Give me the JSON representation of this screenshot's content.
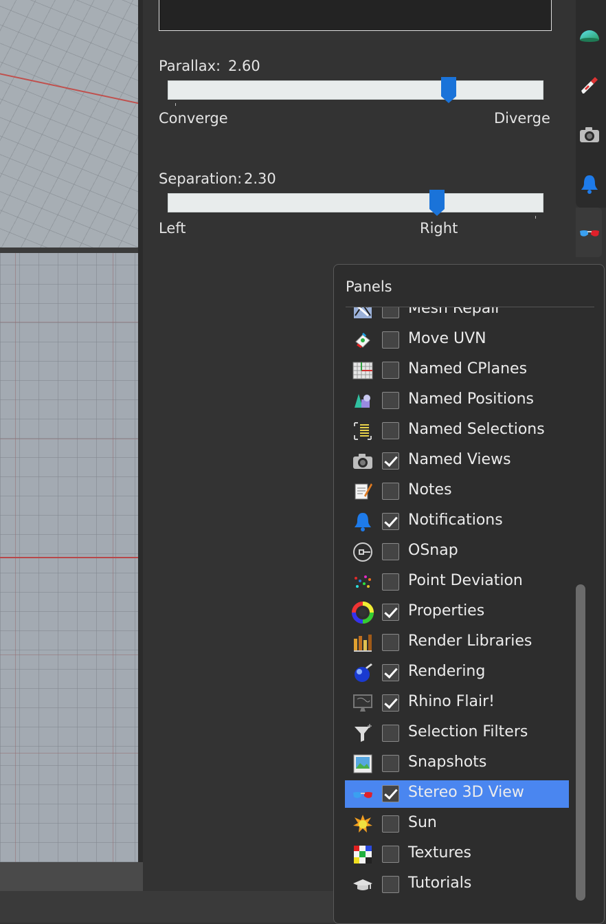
{
  "stereo": {
    "parallax": {
      "label": "Parallax:",
      "value": "2.60",
      "level": 0.75,
      "left_label": "Converge",
      "right_label": "Diverge"
    },
    "separation": {
      "label": "Separation:",
      "value": "2.30",
      "level": 0.72,
      "left_label": "Left",
      "right_label": "Right"
    }
  },
  "side_tabs": [
    {
      "icon": "dome-render-icon"
    },
    {
      "icon": "paint-brush-icon"
    },
    {
      "icon": "camera-icon"
    },
    {
      "icon": "notification-bell-icon"
    },
    {
      "icon": "stereo-glasses-icon",
      "active": true
    }
  ],
  "panels": {
    "title": "Panels",
    "items": [
      {
        "label": "Mesh Repair",
        "checked": false,
        "icon": "mesh-repair-icon"
      },
      {
        "label": "Move UVN",
        "checked": false,
        "icon": "move-uvn-icon"
      },
      {
        "label": "Named CPlanes",
        "checked": false,
        "icon": "named-cplanes-icon"
      },
      {
        "label": "Named Positions",
        "checked": false,
        "icon": "named-positions-icon"
      },
      {
        "label": "Named Selections",
        "checked": false,
        "icon": "named-selections-icon"
      },
      {
        "label": "Named Views",
        "checked": true,
        "icon": "camera-icon"
      },
      {
        "label": "Notes",
        "checked": false,
        "icon": "notes-icon"
      },
      {
        "label": "Notifications",
        "checked": true,
        "icon": "notification-bell-icon"
      },
      {
        "label": "OSnap",
        "checked": false,
        "icon": "osnap-icon"
      },
      {
        "label": "Point Deviation",
        "checked": false,
        "icon": "point-deviation-icon"
      },
      {
        "label": "Properties",
        "checked": true,
        "icon": "properties-color-wheel-icon"
      },
      {
        "label": "Render Libraries",
        "checked": false,
        "icon": "render-libraries-icon"
      },
      {
        "label": "Rendering",
        "checked": true,
        "icon": "rendering-sphere-icon"
      },
      {
        "label": "Rhino Flair!",
        "checked": true,
        "icon": "rhino-flair-icon"
      },
      {
        "label": "Selection Filters",
        "checked": false,
        "icon": "selection-filter-funnel-icon"
      },
      {
        "label": "Snapshots",
        "checked": false,
        "icon": "snapshots-icon"
      },
      {
        "label": "Stereo 3D View",
        "checked": true,
        "icon": "stereo-glasses-icon",
        "selected": true
      },
      {
        "label": "Sun",
        "checked": false,
        "icon": "sun-icon"
      },
      {
        "label": "Textures",
        "checked": false,
        "icon": "textures-icon"
      },
      {
        "label": "Tutorials",
        "checked": false,
        "icon": "tutorials-cap-icon"
      }
    ]
  },
  "colors": {
    "selection": "#4a86f0",
    "slider_thumb": "#1a73d9",
    "panel_bg": "#333333"
  }
}
